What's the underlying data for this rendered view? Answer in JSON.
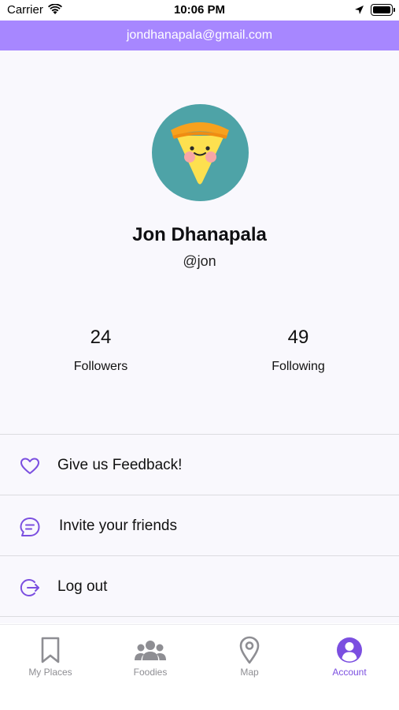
{
  "status_bar": {
    "carrier": "Carrier",
    "time": "10:06 PM",
    "icons": [
      "wifi-icon",
      "location-arrow-icon",
      "battery-icon"
    ]
  },
  "banner": {
    "email": "jondhanapala@gmail.com",
    "color": "#a787ff"
  },
  "profile": {
    "avatar_icon": "pizza-slice-icon",
    "avatar_bg": "#4ea3a7",
    "name": "Jon Dhanapala",
    "handle": "@jon",
    "stats": {
      "followers": {
        "count": "24",
        "label": "Followers"
      },
      "following": {
        "count": "49",
        "label": "Following"
      }
    }
  },
  "menu": {
    "items": [
      {
        "label": "Give us Feedback!",
        "icon": "heart-icon"
      },
      {
        "label": "Invite your friends",
        "icon": "message-icon"
      },
      {
        "label": "Log out",
        "icon": "logout-icon"
      }
    ],
    "icon_color": "#7b4fe0"
  },
  "tab_bar": {
    "tabs": [
      {
        "label": "My Places",
        "icon": "bookmark-icon",
        "active": false
      },
      {
        "label": "Foodies",
        "icon": "people-icon",
        "active": false
      },
      {
        "label": "Map",
        "icon": "map-pin-icon",
        "active": false
      },
      {
        "label": "Account",
        "icon": "account-icon",
        "active": true
      }
    ],
    "active_color": "#7b4fe0",
    "inactive_color": "#8e8e93"
  }
}
